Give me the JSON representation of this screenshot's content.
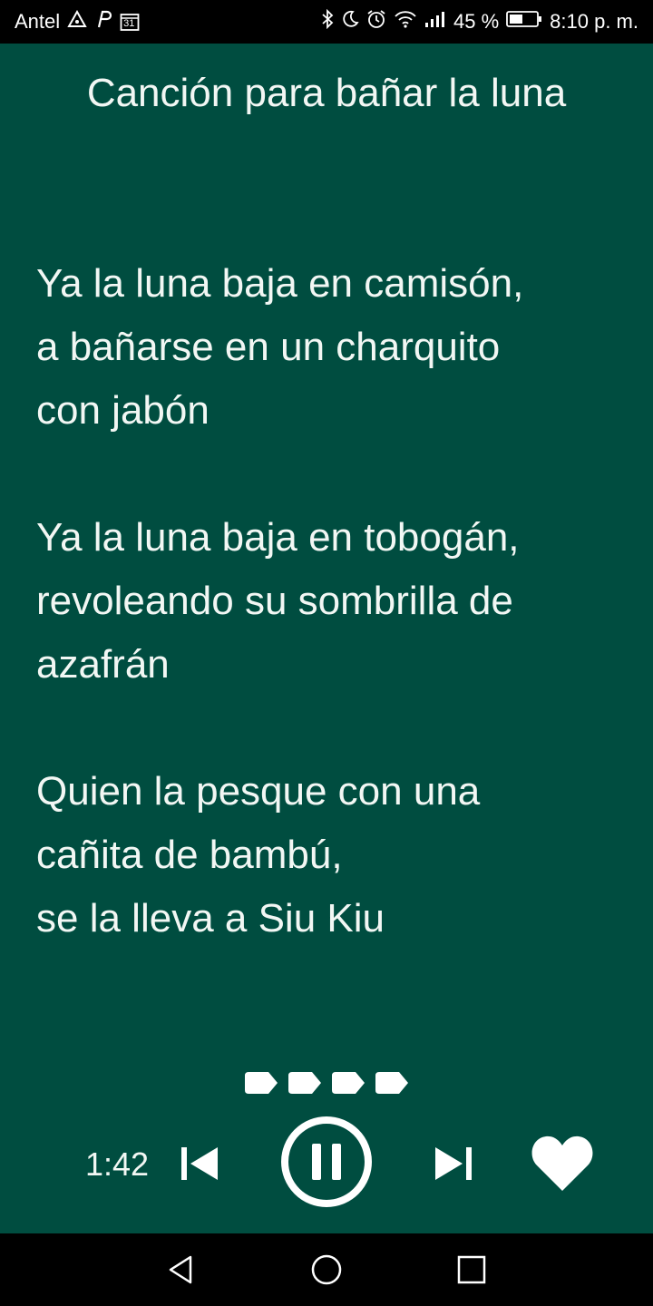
{
  "status_bar": {
    "carrier": "Antel",
    "battery": "45 %",
    "time": "8:10 p. m.",
    "calendar_day": "31",
    "icons": [
      "warning-icon",
      "parking-icon",
      "calendar-icon",
      "bluetooth-icon",
      "moon-icon",
      "alarm-icon",
      "wifi-icon",
      "signal-icon",
      "battery-icon"
    ]
  },
  "song": {
    "title": "Canción para bañar la luna",
    "stanzas": [
      [
        "Ya la luna baja en camisón,",
        "a bañarse en un charquito",
        "con jabón"
      ],
      [
        "Ya la luna baja en tobogán,",
        "revoleando su sombrilla de",
        "azafrán"
      ],
      [
        "Quien la pesque con una",
        "cañita de bambú,",
        "se la lleva a Siu Kiu"
      ]
    ]
  },
  "player": {
    "elapsed": "1:42",
    "progress_segments": 4
  },
  "colors": {
    "background": "#004d40",
    "text": "#f2f7f4",
    "bars": "#000000"
  },
  "nav_bar": {
    "icons": [
      "back-icon",
      "home-icon",
      "recents-icon"
    ]
  }
}
